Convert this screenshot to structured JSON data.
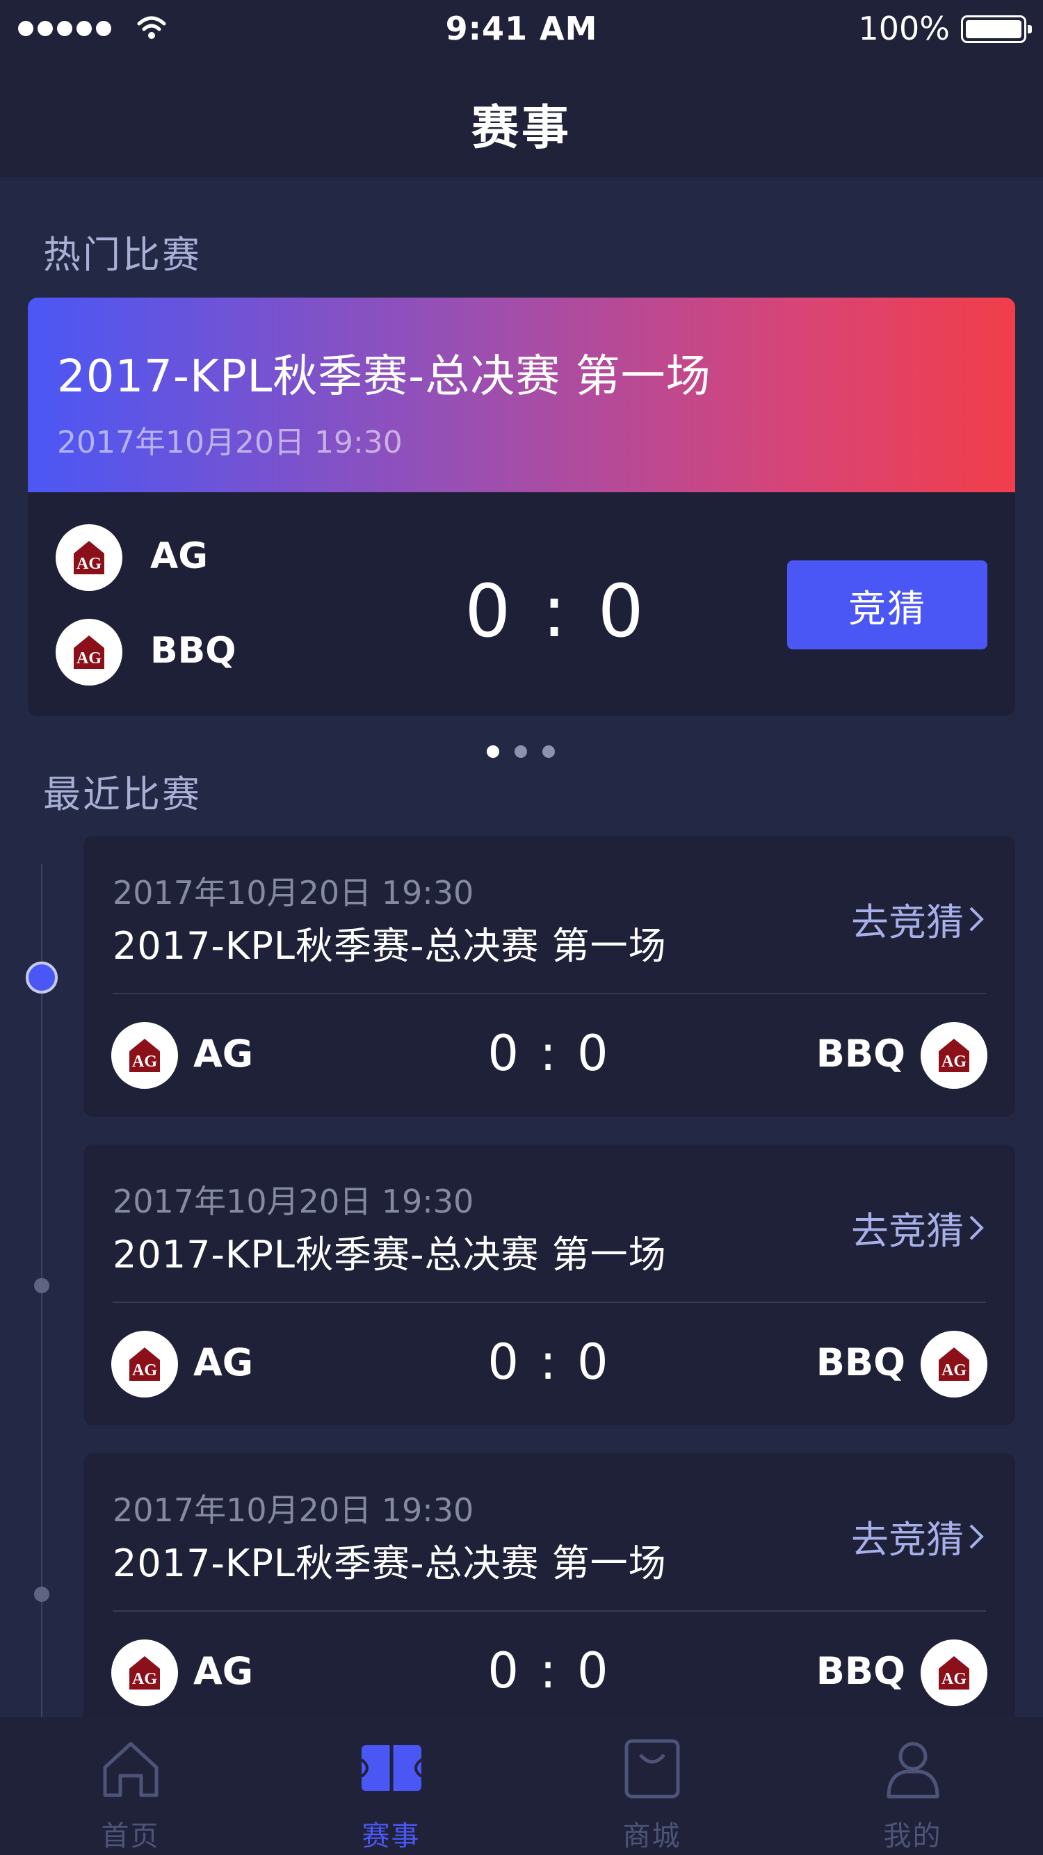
{
  "status_bar": {
    "time": "9:41 AM",
    "battery": "100%"
  },
  "header": {
    "title": "赛事"
  },
  "hot": {
    "section_title": "热门比赛",
    "title": "2017-KPL秋季赛-总决赛 第一场",
    "date": "2017年10月20日 19:30",
    "team_a": "AG",
    "team_b": "BBQ",
    "score": "0 : 0",
    "bet_label": "竞猜",
    "pager_count": 3,
    "pager_active": 0
  },
  "recent": {
    "section_title": "最近比赛",
    "matches": [
      {
        "date": "2017年10月20日 19:30",
        "title": "2017-KPL秋季赛-总决赛 第一场",
        "link": "去竞猜",
        "team_left": "AG",
        "team_right": "BBQ",
        "score": "0 : 0"
      },
      {
        "date": "2017年10月20日 19:30",
        "title": "2017-KPL秋季赛-总决赛 第一场",
        "link": "去竞猜",
        "team_left": "AG",
        "team_right": "BBQ",
        "score": "0 : 0"
      },
      {
        "date": "2017年10月20日 19:30",
        "title": "2017-KPL秋季赛-总决赛 第一场",
        "link": "去竞猜",
        "team_left": "AG",
        "team_right": "BBQ",
        "score": "0 : 0"
      }
    ]
  },
  "tabs": [
    {
      "label": "首页",
      "icon": "home-icon",
      "active": false
    },
    {
      "label": "赛事",
      "icon": "court-icon",
      "active": true
    },
    {
      "label": "商城",
      "icon": "bag-icon",
      "active": false
    },
    {
      "label": "我的",
      "icon": "user-icon",
      "active": false
    }
  ],
  "colors": {
    "background": "#232844",
    "card": "#1e2137",
    "accent": "#4b57f5",
    "gradient_start": "#4b57f5",
    "gradient_end": "#f13e4a"
  }
}
